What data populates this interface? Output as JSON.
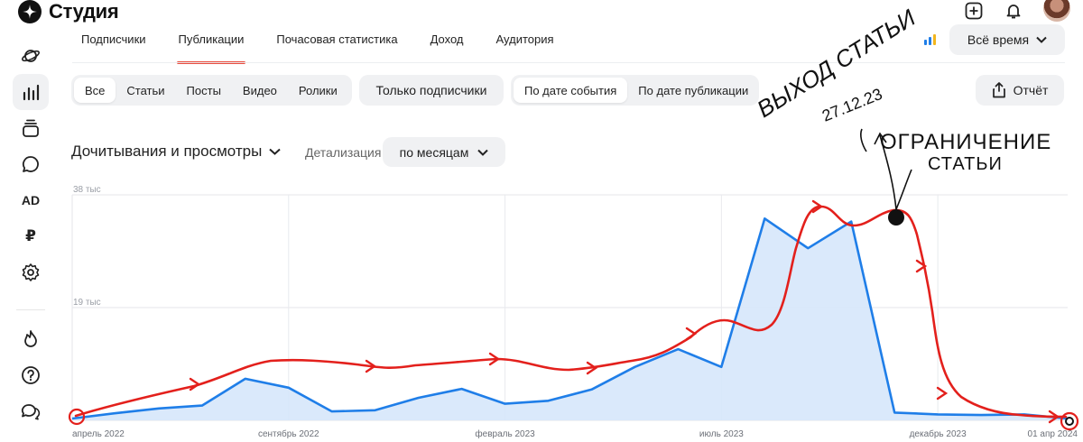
{
  "header": {
    "app_title": "Студия"
  },
  "tabs": [
    {
      "label": "Подписчики",
      "active": false
    },
    {
      "label": "Публикации",
      "active": true
    },
    {
      "label": "Почасовая статистика",
      "active": false
    },
    {
      "label": "Доход",
      "active": false
    },
    {
      "label": "Аудитория",
      "active": false
    }
  ],
  "period": {
    "label": "Всё время"
  },
  "filters": {
    "types": [
      "Все",
      "Статьи",
      "Посты",
      "Видео",
      "Ролики"
    ],
    "subscribers_only": "Только подписчики",
    "date_modes": [
      "По дате события",
      "По дате публикации"
    ],
    "report": "Отчёт"
  },
  "chart_header": {
    "metric": "Дочитывания и просмотры",
    "detail_label": "Детализация",
    "detail_value": "по месяцам"
  },
  "sidebar": {
    "icons": [
      "planet-icon",
      "stats-icon",
      "stack-icon",
      "chat-icon",
      "ad-icon",
      "ruble-icon",
      "gear-icon",
      "fire-icon",
      "help-icon",
      "messages-icon"
    ],
    "ad_text": "AD",
    "ruble_text": "₽"
  },
  "colors": {
    "accent": "#e8483a",
    "line": "#1f7ee8",
    "fill": "#d6e7fb",
    "annotation": "#e3201c"
  },
  "annotations": {
    "note1_line1": "ВЫХОД СТАТЬИ",
    "note1_line2": "27.12.23",
    "note2_line1": "ОГРАНИЧЕНИЕ",
    "note2_line2": "СТАТЬИ"
  },
  "chart_data": {
    "type": "area",
    "ylim": [
      0,
      38000
    ],
    "y_ticks": [
      {
        "value": 38000,
        "label": "38 тыс"
      },
      {
        "value": 19000,
        "label": "19 тыс"
      }
    ],
    "x_ticks": [
      "апрель 2022",
      "сентябрь 2022",
      "февраль 2023",
      "июль 2023",
      "декабрь 2023",
      "01 апр 2024"
    ],
    "x_tick_index": [
      0,
      5,
      10,
      15,
      20,
      24
    ],
    "series": [
      {
        "values": [
          300,
          1200,
          2000,
          2500,
          7000,
          5500,
          1500,
          1700,
          3800,
          5300,
          2800,
          3300,
          5200,
          9000,
          12000,
          9000,
          34000,
          29000,
          33500,
          1300,
          1000,
          900,
          1000,
          300
        ]
      }
    ],
    "x": [
      0,
      1,
      2,
      3,
      4,
      5,
      6,
      7,
      8,
      9,
      10,
      11,
      12,
      13,
      14,
      15,
      16,
      17,
      18,
      19,
      20,
      21,
      22,
      23
    ]
  }
}
